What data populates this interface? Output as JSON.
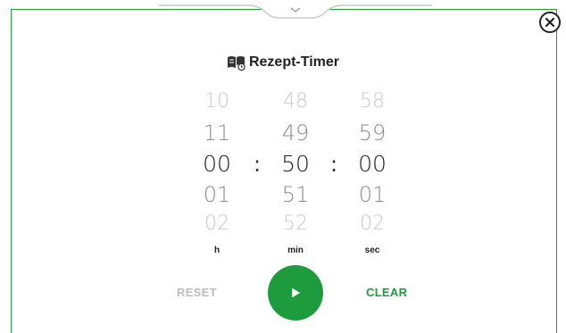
{
  "title": "Rezept-Timer",
  "icons": {
    "close": "close-icon",
    "title": "recipe-book-timer-icon",
    "play": "play-icon",
    "handle": "chevron-down-icon"
  },
  "colors": {
    "accent": "#1e9b3c",
    "muted": "#bdbdbd"
  },
  "picker": {
    "hours": {
      "items": [
        "10",
        "11",
        "00",
        "01",
        "02"
      ],
      "selected": "00",
      "unit": "h"
    },
    "minutes": {
      "items": [
        "48",
        "49",
        "50",
        "51",
        "52"
      ],
      "selected": "50",
      "unit": "min"
    },
    "seconds": {
      "items": [
        "58",
        "59",
        "00",
        "01",
        "02"
      ],
      "selected": "00",
      "unit": "sec"
    },
    "separator": ":"
  },
  "actions": {
    "reset": "RESET",
    "clear": "CLEAR"
  }
}
